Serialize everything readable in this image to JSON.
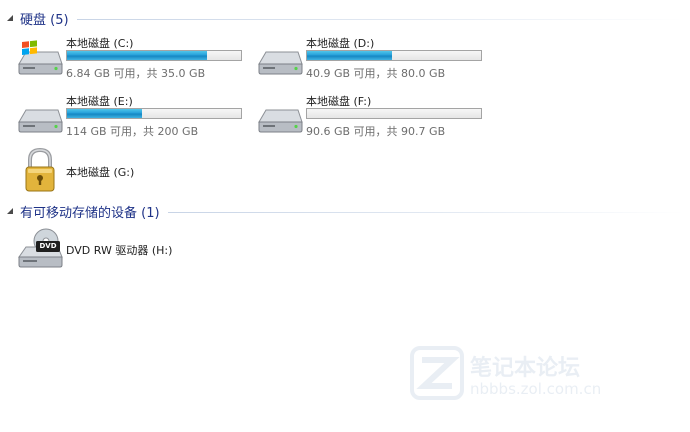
{
  "groups": {
    "hard_disks": {
      "title": "硬盘 (5)",
      "drives": [
        {
          "name": "本地磁盘 (C:)",
          "free_text": "6.84 GB 可用，共 35.0 GB",
          "used_fraction": 0.805,
          "icon": "windows-drive-icon"
        },
        {
          "name": "本地磁盘 (D:)",
          "free_text": "40.9 GB 可用，共 80.0 GB",
          "used_fraction": 0.489,
          "icon": "hard-drive-icon"
        },
        {
          "name": "本地磁盘 (E:)",
          "free_text": "114 GB 可用，共 200 GB",
          "used_fraction": 0.43,
          "icon": "hard-drive-icon"
        },
        {
          "name": "本地磁盘 (F:)",
          "free_text": "90.6 GB 可用，共 90.7 GB",
          "used_fraction": 0.001,
          "icon": "hard-drive-icon"
        },
        {
          "name": "本地磁盘 (G:)",
          "icon": "locked-drive-icon"
        }
      ]
    },
    "removable": {
      "title": "有可移动存储的设备 (1)",
      "devices": [
        {
          "name": "DVD RW 驱动器 (H:)",
          "icon": "dvd-drive-icon",
          "badge": "DVD"
        }
      ]
    }
  },
  "watermark": {
    "line1": "笔记本论坛",
    "line2": "nbbbs.zol.com.cn"
  },
  "colors": {
    "accent_bar": "#26a0da",
    "group_title": "#1e3287",
    "free_text": "#6d6d6d"
  }
}
